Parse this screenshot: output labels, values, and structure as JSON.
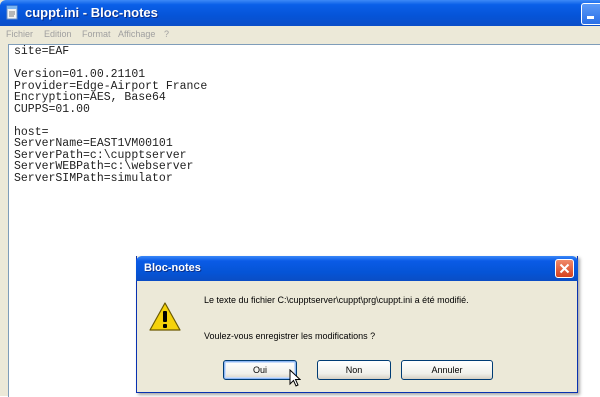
{
  "window": {
    "title": "cuppt.ini - Bloc-notes"
  },
  "menu": [
    {
      "label": "Fichier"
    },
    {
      "label": "Edition"
    },
    {
      "label": "Format"
    },
    {
      "label": "Affichage"
    },
    {
      "label": "?"
    }
  ],
  "editor": {
    "lines": [
      "site=EAF",
      "",
      "Version=01.00.21101",
      "Provider=Edge-Airport France",
      "Encryption=AES, Base64",
      "CUPPS=01.00",
      "",
      "host=",
      "ServerName=EAST1VM00101",
      "ServerPath=c:\\cupptserver",
      "ServerWEBPath=c:\\webserver",
      "ServerSIMPath=simulator"
    ]
  },
  "dialog": {
    "title": "Bloc-notes",
    "message1": "Le texte du fichier C:\\cupptserver\\cuppt\\prg\\cuppt.ini a été modifié.",
    "message2": "Voulez-vous enregistrer les modifications ?",
    "buttons": {
      "yes": "Oui",
      "no": "Non",
      "cancel": "Annuler"
    }
  },
  "icons": {
    "app": "notepad-icon",
    "warning": "warning-icon",
    "close": "close-icon",
    "cursor": "mouse-cursor-icon"
  },
  "colors": {
    "titlebar": "#0a5fe8",
    "close_button": "#d6411f",
    "warning": "#f5d20a"
  }
}
